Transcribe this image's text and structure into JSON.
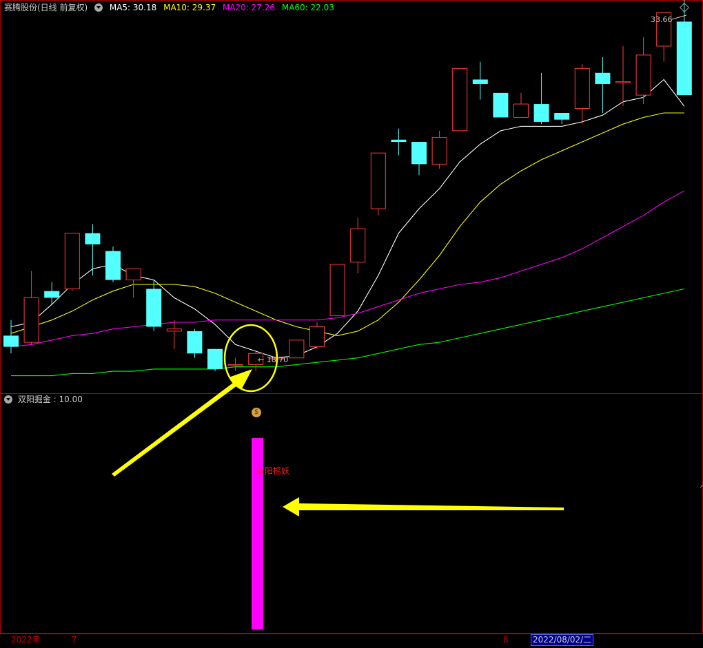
{
  "header": {
    "title": "赛腾股份(日线 前复权)",
    "ma5_label": "MA5: 30.18",
    "ma10_label": "MA10: 29.37",
    "ma20_label": "MA20: 27.26",
    "ma60_label": "MA60: 22.03"
  },
  "sub_header": {
    "label": "双阳掘金 : 10.00",
    "bar_text": "双阳摇妖"
  },
  "axis": {
    "year_label": "2022年",
    "month_july": "7",
    "month_aug": "8",
    "cursor_date": "2022/08/02/二"
  },
  "annotations": {
    "high_label": "33.66",
    "low_label": "18.70"
  },
  "colors": {
    "up": "#ff3c3c",
    "down": "#54ffff",
    "ma5": "#ffffff",
    "ma10": "#ffff00",
    "ma20": "#ff00ff",
    "ma60": "#00ff00",
    "signal_bar": "#ff00ff",
    "arrow": "#ffff00",
    "frame": "#b00000"
  },
  "icon_names": [
    "chevron-down-icon",
    "diamond-icon",
    "money-bag-icon"
  ],
  "chart_data": {
    "type": "candlestick",
    "title": "赛腾股份(日线 前复权)",
    "price_range": [
      17.5,
      34.6
    ],
    "candles": [
      {
        "o": 19.9,
        "c": 19.4,
        "h": 20.6,
        "l": 19.1
      },
      {
        "o": 19.6,
        "c": 21.6,
        "h": 22.8,
        "l": 19.5
      },
      {
        "o": 21.9,
        "c": 21.6,
        "h": 22.3,
        "l": 21.3
      },
      {
        "o": 22.0,
        "c": 24.5,
        "h": 24.5,
        "l": 21.9
      },
      {
        "o": 24.5,
        "c": 24.0,
        "h": 24.9,
        "l": 22.6
      },
      {
        "o": 23.7,
        "c": 22.4,
        "h": 23.9,
        "l": 22.3
      },
      {
        "o": 22.4,
        "c": 22.9,
        "h": 22.9,
        "l": 21.6
      },
      {
        "o": 22.0,
        "c": 20.3,
        "h": 22.4,
        "l": 20.1
      },
      {
        "o": 20.1,
        "c": 20.2,
        "h": 20.6,
        "l": 19.3
      },
      {
        "o": 20.1,
        "c": 19.1,
        "h": 20.2,
        "l": 18.9
      },
      {
        "o": 19.3,
        "c": 18.4,
        "h": 19.3,
        "l": 18.3
      },
      {
        "o": 18.6,
        "c": 18.6,
        "h": 18.9,
        "l": 18.3
      },
      {
        "o": 18.6,
        "c": 19.1,
        "h": 19.2,
        "l": 18.3
      },
      {
        "o": 18.9,
        "c": 18.9,
        "h": 19.1,
        "l": 18.7
      },
      {
        "o": 18.9,
        "c": 19.7,
        "h": 19.7,
        "l": 18.9
      },
      {
        "o": 19.4,
        "c": 20.3,
        "h": 20.5,
        "l": 19.3
      },
      {
        "o": 20.8,
        "c": 23.1,
        "h": 23.1,
        "l": 20.8
      },
      {
        "o": 23.2,
        "c": 24.7,
        "h": 25.2,
        "l": 22.7
      },
      {
        "o": 25.6,
        "c": 28.1,
        "h": 28.1,
        "l": 25.3
      },
      {
        "o": 28.7,
        "c": 28.6,
        "h": 29.2,
        "l": 28.0
      },
      {
        "o": 28.6,
        "c": 27.6,
        "h": 28.6,
        "l": 27.1
      },
      {
        "o": 27.6,
        "c": 28.8,
        "h": 29.1,
        "l": 27.4
      },
      {
        "o": 29.1,
        "c": 31.9,
        "h": 31.9,
        "l": 29.1
      },
      {
        "o": 31.4,
        "c": 31.2,
        "h": 32.2,
        "l": 30.5
      },
      {
        "o": 30.8,
        "c": 29.7,
        "h": 30.8,
        "l": 29.7
      },
      {
        "o": 29.7,
        "c": 30.3,
        "h": 30.8,
        "l": 29.7
      },
      {
        "o": 30.3,
        "c": 29.5,
        "h": 31.7,
        "l": 29.4
      },
      {
        "o": 29.9,
        "c": 29.6,
        "h": 29.9,
        "l": 29.4
      },
      {
        "o": 30.1,
        "c": 31.9,
        "h": 32.1,
        "l": 29.4
      },
      {
        "o": 31.7,
        "c": 31.2,
        "h": 32.4,
        "l": 29.9
      },
      {
        "o": 31.3,
        "c": 31.3,
        "h": 32.9,
        "l": 30.2
      },
      {
        "o": 30.7,
        "c": 32.5,
        "h": 33.3,
        "l": 30.3
      },
      {
        "o": 32.9,
        "c": 34.4,
        "h": 34.4,
        "l": 32.2
      },
      {
        "o": 34.0,
        "c": 30.7,
        "h": 35.3,
        "l": 30.7
      }
    ],
    "ma5": [
      20.3,
      20.5,
      21.3,
      22.2,
      22.9,
      23.1,
      22.6,
      22.4,
      21.6,
      21.1,
      20.4,
      19.5,
      19.2,
      18.9,
      19.0,
      19.4,
      20.0,
      21.0,
      22.6,
      24.5,
      25.6,
      26.5,
      27.7,
      28.5,
      29.1,
      29.3,
      29.3,
      29.3,
      29.5,
      29.8,
      30.4,
      30.6,
      31.4,
      30.2
    ],
    "ma10": [
      20.0,
      20.3,
      20.6,
      21.0,
      21.5,
      21.9,
      22.2,
      22.2,
      22.2,
      22.1,
      21.8,
      21.4,
      21.0,
      20.6,
      20.3,
      20.1,
      19.9,
      20.1,
      20.6,
      21.4,
      22.4,
      23.5,
      24.8,
      25.9,
      26.7,
      27.3,
      27.8,
      28.2,
      28.6,
      29.0,
      29.4,
      29.7,
      29.9,
      29.9
    ],
    "ma20": [
      19.4,
      19.5,
      19.7,
      19.9,
      20.0,
      20.2,
      20.3,
      20.4,
      20.5,
      20.5,
      20.6,
      20.6,
      20.6,
      20.6,
      20.6,
      20.6,
      20.7,
      20.9,
      21.2,
      21.5,
      21.8,
      22.0,
      22.2,
      22.3,
      22.5,
      22.8,
      23.1,
      23.4,
      23.8,
      24.3,
      24.8,
      25.3,
      25.9,
      26.4
    ],
    "ma60": [
      18.1,
      18.1,
      18.1,
      18.2,
      18.2,
      18.3,
      18.3,
      18.4,
      18.4,
      18.4,
      18.4,
      18.5,
      18.5,
      18.5,
      18.6,
      18.7,
      18.8,
      18.9,
      19.1,
      19.3,
      19.5,
      19.6,
      19.8,
      20.0,
      20.2,
      20.4,
      20.6,
      20.8,
      21.0,
      21.2,
      21.4,
      21.6,
      21.8,
      22.0
    ],
    "indicator": {
      "name": "双阳掘金",
      "value": 10.0,
      "signal_index": 12,
      "signal_value": 10.0
    },
    "high": 33.66,
    "low": 18.7
  }
}
